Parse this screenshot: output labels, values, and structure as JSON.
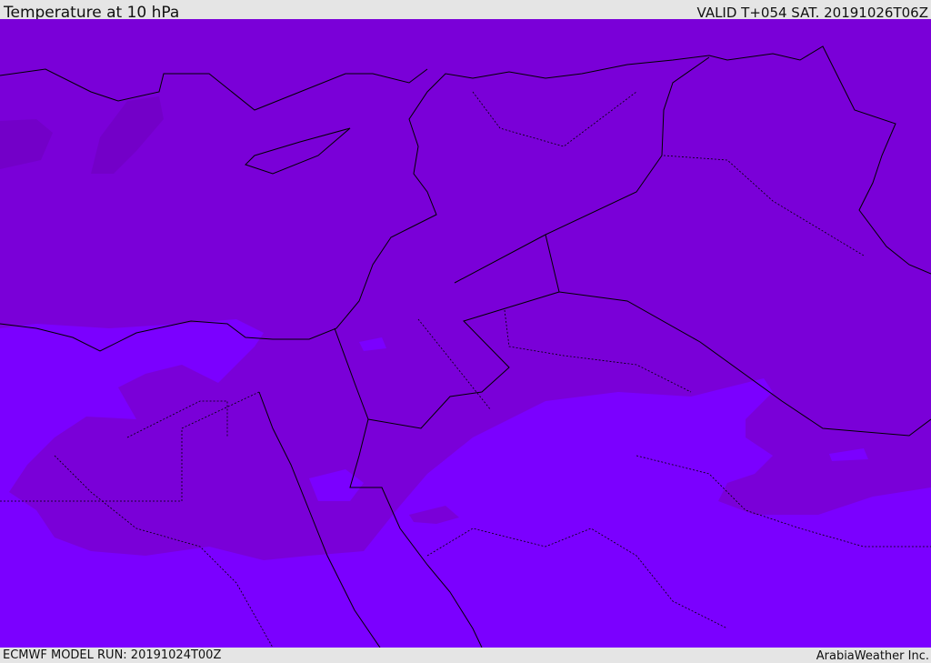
{
  "header": {
    "title": "Temperature at 10 hPa",
    "valid": "VALID T+054 SAT. 20191026T06Z"
  },
  "footer": {
    "model_run": "ECMWF MODEL RUN: 20191024T00Z",
    "credit": "ArabiaWeather Inc."
  },
  "colors": {
    "colder_band": "#7a00d8",
    "warmer_band": "#7b00ff",
    "background": "#e5e5e5",
    "boundaries": "#000000"
  }
}
